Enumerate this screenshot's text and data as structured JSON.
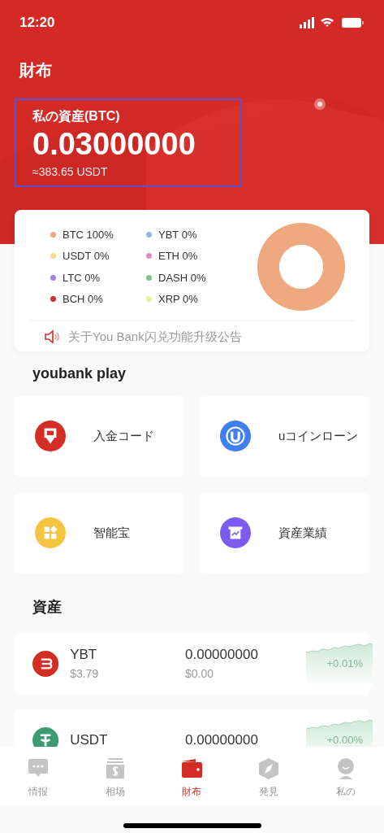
{
  "status_bar": {
    "time": "12:20"
  },
  "header": {
    "title": "財布",
    "balance_label": "私の資産(BTC)",
    "balance": "0.03000000",
    "balance_usdt": "≈383.65 USDT"
  },
  "allocation": {
    "legend": [
      {
        "label": "BTC 100%",
        "color": "#eea97f"
      },
      {
        "label": "YBT 0%",
        "color": "#8fb8e0"
      },
      {
        "label": "USDT 0%",
        "color": "#f1dc8a"
      },
      {
        "label": "ETH 0%",
        "color": "#dd88cc"
      },
      {
        "label": "LTC 0%",
        "color": "#a77ded"
      },
      {
        "label": "DASH 0%",
        "color": "#7cc48e"
      },
      {
        "label": "BCH 0%",
        "color": "#cc3030"
      },
      {
        "label": "XRP 0%",
        "color": "#eaf0a0"
      }
    ],
    "chart_data": {
      "type": "donut",
      "values": [
        100,
        0,
        0,
        0,
        0,
        0,
        0,
        0
      ]
    },
    "notice": "关于You Bank闪兑功能升级公告"
  },
  "play": {
    "title": "youbank play",
    "tiles": [
      {
        "label": "入金コード",
        "kind": "deposit",
        "color": "#d42d26"
      },
      {
        "label": "uコインローン",
        "kind": "loan",
        "color": "#3f7ff0"
      },
      {
        "label": "智能宝",
        "kind": "smart",
        "color": "#f4c541"
      },
      {
        "label": "資産業績",
        "kind": "performance",
        "color": "#7b5cf0"
      }
    ]
  },
  "assets": {
    "title": "資産",
    "rows": [
      {
        "symbol": "YBT",
        "kind": "ybt",
        "amount": "0.00000000",
        "price": "$3.79",
        "value": "$0.00",
        "change": "+0.01%"
      },
      {
        "symbol": "USDT",
        "kind": "usdt",
        "amount": "0.00000000",
        "change": "+0.00%"
      }
    ]
  },
  "tab_bar": [
    {
      "label": "情报",
      "kind": "chat",
      "selected": false
    },
    {
      "label": "相场",
      "kind": "money",
      "selected": false
    },
    {
      "label": "財布",
      "kind": "wallet",
      "selected": true
    },
    {
      "label": "発見",
      "kind": "compass",
      "selected": false
    },
    {
      "label": "私の",
      "kind": "person",
      "selected": false
    }
  ]
}
